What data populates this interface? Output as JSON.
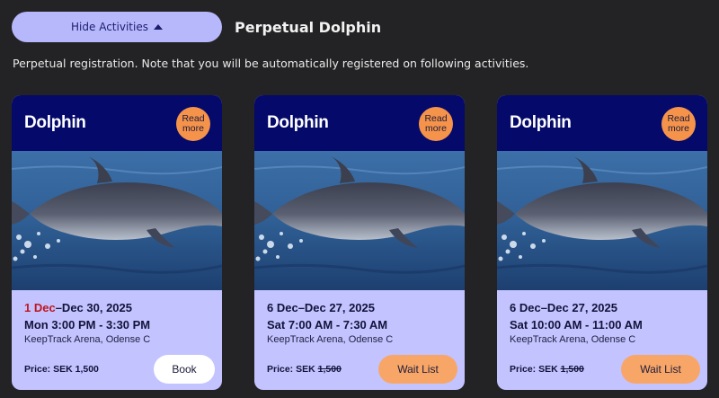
{
  "toolbar": {
    "hide_label": "Hide Activities"
  },
  "header": {
    "title": "Perpetual Dolphin"
  },
  "note": "Perpetual registration. Note that you will be automatically registered on following activities.",
  "cards": [
    {
      "title": "Dolphin",
      "read_more": "Read more",
      "date_start": "1 Dec",
      "date_rest": "–Dec 30, 2025",
      "time": "Mon 3:00 PM - 3:30 PM",
      "venue": "KeepTrack Arena, Odense C",
      "price_label": "Price: SEK",
      "price": "1,500",
      "action": "Book"
    },
    {
      "title": "Dolphin",
      "read_more": "Read more",
      "dates": "6 Dec–Dec 27, 2025",
      "time": "Sat 7:00 AM - 7:30 AM",
      "venue": "KeepTrack Arena, Odense C",
      "price_label": "Price: SEK",
      "price": "1,500",
      "action": "Wait List"
    },
    {
      "title": "Dolphin",
      "read_more": "Read more",
      "dates": "6 Dec–Dec 27, 2025",
      "time": "Sat 10:00 AM - 11:00 AM",
      "venue": "KeepTrack Arena, Odense C",
      "price_label": "Price: SEK",
      "price": "1,500",
      "action": "Wait List"
    }
  ],
  "colors": {
    "accent": "#b7b8fb",
    "card_head": "#04096a",
    "card_body": "#c3c3ff",
    "read_more": "#f5934b",
    "wait_list": "#f8a668",
    "highlight_date": "#c0161e"
  }
}
